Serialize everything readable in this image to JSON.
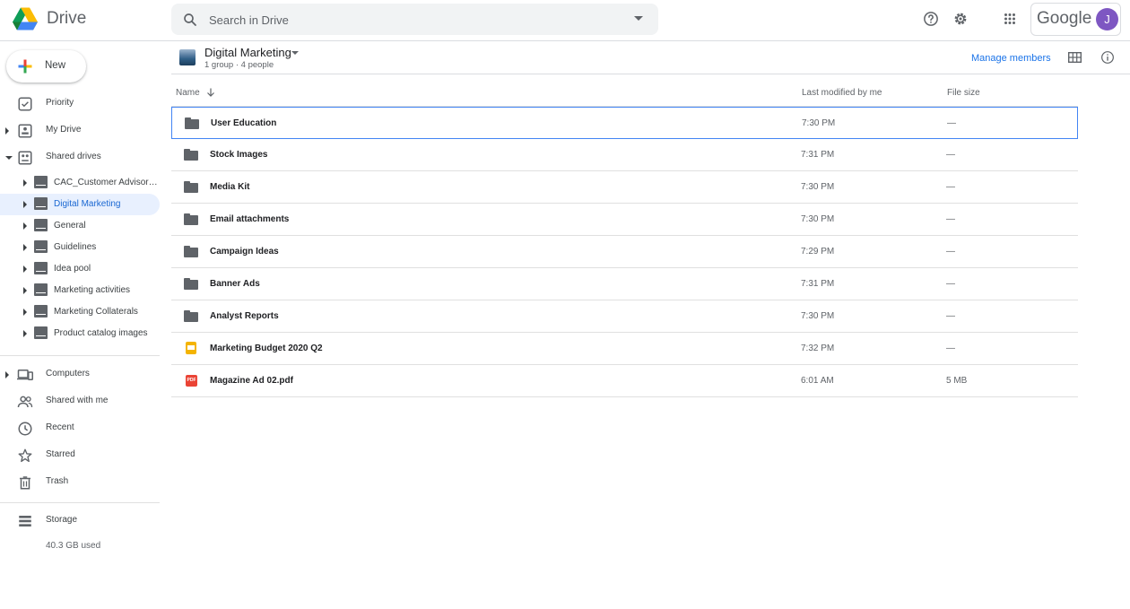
{
  "app": {
    "name": "Drive"
  },
  "search": {
    "placeholder": "Search in Drive"
  },
  "header": {
    "brand": "Google",
    "avatar_initial": "J"
  },
  "sidebar": {
    "new_label": "New",
    "top_items": [
      {
        "label": "Priority",
        "icon": "check-circle-icon"
      },
      {
        "label": "My Drive",
        "icon": "my-drive-icon"
      },
      {
        "label": "Shared drives",
        "icon": "shared-drives-icon"
      }
    ],
    "shared_drives": [
      {
        "label": "CAC_Customer Advisory ..."
      },
      {
        "label": "Digital Marketing",
        "active": true
      },
      {
        "label": "General"
      },
      {
        "label": "Guidelines"
      },
      {
        "label": "Idea pool"
      },
      {
        "label": "Marketing activities"
      },
      {
        "label": "Marketing Collaterals"
      },
      {
        "label": "Product catalog images"
      }
    ],
    "bottom_items": [
      {
        "label": "Computers",
        "icon": "computer-icon"
      },
      {
        "label": "Shared with me",
        "icon": "people-icon"
      },
      {
        "label": "Recent",
        "icon": "clock-icon"
      },
      {
        "label": "Starred",
        "icon": "star-icon"
      },
      {
        "label": "Trash",
        "icon": "trash-icon"
      }
    ],
    "storage": {
      "label": "Storage",
      "used": "40.3 GB used"
    }
  },
  "breadcrumb": {
    "title": "Digital Marketing",
    "subtitle": "1 group · 4 people"
  },
  "toolbar": {
    "manage_members": "Manage members"
  },
  "table": {
    "columns": {
      "name": "Name",
      "modified": "Last modified by me",
      "size": "File size"
    },
    "rows": [
      {
        "name": "User Education",
        "type": "folder",
        "modified": "7:30 PM",
        "size": "—"
      },
      {
        "name": "Stock Images",
        "type": "folder",
        "modified": "7:31 PM",
        "size": "—"
      },
      {
        "name": "Media Kit",
        "type": "folder",
        "modified": "7:30 PM",
        "size": "—"
      },
      {
        "name": "Email attachments",
        "type": "folder",
        "modified": "7:30 PM",
        "size": "—"
      },
      {
        "name": "Campaign Ideas",
        "type": "folder",
        "modified": "7:29 PM",
        "size": "—"
      },
      {
        "name": "Banner Ads",
        "type": "folder",
        "modified": "7:31 PM",
        "size": "—"
      },
      {
        "name": "Analyst Reports",
        "type": "folder",
        "modified": "7:30 PM",
        "size": "—"
      },
      {
        "name": "Marketing Budget 2020 Q2",
        "type": "slides",
        "modified": "7:32 PM",
        "size": "—"
      },
      {
        "name": "Magazine Ad 02.pdf",
        "type": "pdf",
        "modified": "6:01 AM",
        "size": "5 MB",
        "badge": "PDF"
      }
    ]
  }
}
